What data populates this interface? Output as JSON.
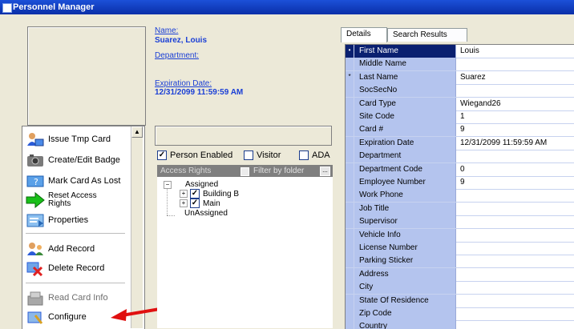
{
  "window": {
    "title": "Personnel Manager"
  },
  "person": {
    "name_label": "Name:",
    "name_value": "Suarez, Louis",
    "department_label": "Department:",
    "expiration_label": "Expiration Date:",
    "expiration_value": "12/31/2099 11:59:59 AM"
  },
  "actions": [
    {
      "label": "Issue Tmp Card",
      "icon": "person-card-icon",
      "enabled": true
    },
    {
      "label": "Create/Edit Badge",
      "icon": "camera-icon",
      "enabled": true
    },
    {
      "label": "Mark Card As Lost",
      "icon": "lost-card-icon",
      "enabled": true
    },
    {
      "label": "Reset Access Rights",
      "icon": "arrow-right-icon",
      "enabled": true
    },
    {
      "label": "Properties",
      "icon": "properties-icon",
      "enabled": true
    },
    {
      "label": "Add Record",
      "icon": "add-person-icon",
      "enabled": true
    },
    {
      "label": "Delete Record",
      "icon": "delete-icon",
      "enabled": true
    },
    {
      "label": "Read Card Info",
      "icon": "card-reader-icon",
      "enabled": false
    },
    {
      "label": "Configure",
      "icon": "configure-icon",
      "enabled": true
    }
  ],
  "options": {
    "person_enabled": {
      "label": "Person Enabled",
      "checked": true
    },
    "visitor": {
      "label": "Visitor",
      "checked": false
    },
    "ada": {
      "label": "ADA",
      "checked": false
    }
  },
  "access_rights": {
    "header": "Access Rights",
    "filter_label": "Filter by folder",
    "more_label": "...",
    "tree": {
      "assigned": "Assigned",
      "items": [
        {
          "label": "Building B",
          "checked": true
        },
        {
          "label": "Main",
          "checked": true
        }
      ],
      "unassigned": "UnAssigned"
    }
  },
  "tabs": [
    {
      "label": "Details"
    },
    {
      "label": "Search Results"
    }
  ],
  "details": [
    {
      "name": "First Name",
      "value": "Louis",
      "marker": "•"
    },
    {
      "name": "Middle Name",
      "value": "",
      "marker": ""
    },
    {
      "name": "Last Name",
      "value": "Suarez",
      "marker": "*"
    },
    {
      "name": "SocSecNo",
      "value": "",
      "marker": ""
    },
    {
      "name": "Card Type",
      "value": "Wiegand26",
      "marker": ""
    },
    {
      "name": "Site Code",
      "value": "1",
      "marker": ""
    },
    {
      "name": "Card #",
      "value": "9",
      "marker": ""
    },
    {
      "name": "Expiration Date",
      "value": "12/31/2099 11:59:59 AM",
      "marker": ""
    },
    {
      "name": "Department",
      "value": "",
      "marker": ""
    },
    {
      "name": "Department Code",
      "value": "0",
      "marker": ""
    },
    {
      "name": "Employee Number",
      "value": "9",
      "marker": ""
    },
    {
      "name": "Work Phone",
      "value": "",
      "marker": ""
    },
    {
      "name": "Job Title",
      "value": "",
      "marker": ""
    },
    {
      "name": "Supervisor",
      "value": "",
      "marker": ""
    },
    {
      "name": "Vehicle Info",
      "value": "",
      "marker": ""
    },
    {
      "name": "License Number",
      "value": "",
      "marker": ""
    },
    {
      "name": "Parking Sticker",
      "value": "",
      "marker": ""
    },
    {
      "name": "Address",
      "value": "",
      "marker": ""
    },
    {
      "name": "City",
      "value": "",
      "marker": ""
    },
    {
      "name": "State Of Residence",
      "value": "",
      "marker": ""
    },
    {
      "name": "Zip Code",
      "value": "",
      "marker": ""
    },
    {
      "name": "Country",
      "value": "",
      "marker": ""
    }
  ],
  "colors": {
    "title_bar": "#1c50d8",
    "link": "#1a3fd6",
    "grid_label_bg": "#b4c4ee",
    "annotation_arrow": "#e01010"
  }
}
